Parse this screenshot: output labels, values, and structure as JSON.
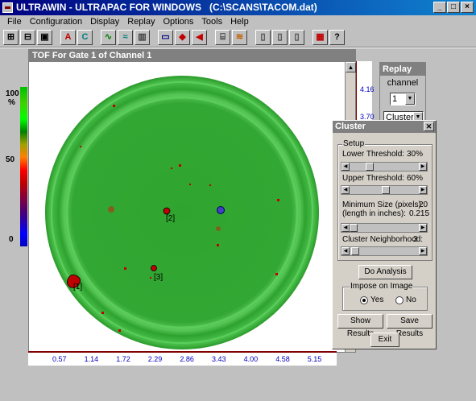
{
  "window": {
    "app_name": "ULTRAWIN",
    "title_rest": " - ULTRAPAC FOR WINDOWS   (C:\\SCANS\\TACOM.dat)",
    "min": "_",
    "max": "□",
    "close": "×"
  },
  "menu": [
    {
      "label": "File"
    },
    {
      "label": "Configuration"
    },
    {
      "label": "Display"
    },
    {
      "label": "Replay"
    },
    {
      "label": "Options"
    },
    {
      "label": "Tools"
    },
    {
      "label": "Help"
    }
  ],
  "toolbar": [
    {
      "glyph": "⊞",
      "color": "#000000"
    },
    {
      "glyph": "⊟",
      "color": "#000000"
    },
    {
      "glyph": "▣",
      "color": "#000000"
    },
    {
      "glyph": "A",
      "color": "#c00000"
    },
    {
      "glyph": "C",
      "color": "#008080"
    },
    {
      "glyph": "∿",
      "color": "#008000"
    },
    {
      "glyph": "≈",
      "color": "#008080"
    },
    {
      "glyph": "▥",
      "color": "#404040"
    },
    {
      "glyph": "▭",
      "color": "#000080"
    },
    {
      "glyph": "◆",
      "color": "#c00000"
    },
    {
      "glyph": "◀",
      "color": "#c00000"
    },
    {
      "glyph": "⌸",
      "color": "#404040"
    },
    {
      "glyph": "≋",
      "color": "#c06000"
    },
    {
      "glyph": "▯",
      "color": "#404040"
    },
    {
      "glyph": "▯",
      "color": "#404040"
    },
    {
      "glyph": "▯",
      "color": "#404040"
    },
    {
      "glyph": "▦",
      "color": "#c00000"
    },
    {
      "glyph": "?",
      "color": "#000000"
    }
  ],
  "image_window": {
    "title": "TOF For Gate 1 of Channel 1",
    "scroll_up": "▲",
    "scroll_down": "▼"
  },
  "scale": {
    "top": "100",
    "unit": "%",
    "mid": "50",
    "bottom": "0"
  },
  "right_ruler": {
    "v1": "4.16",
    "v2": "3.70"
  },
  "bottom_ruler": [
    "0.57",
    "1.14",
    "1.72",
    "2.29",
    "2.86",
    "3.43",
    "4.00",
    "4.58",
    "5.15"
  ],
  "defects": [
    {
      "label": "[1]"
    },
    {
      "label": "[2]"
    },
    {
      "label": "[3]"
    }
  ],
  "replay": {
    "title": "Replay",
    "channel_label": "channel",
    "channel_value": "1",
    "mode_value": "Cluster"
  },
  "cluster": {
    "title": "Cluster",
    "setup_title": "Setup",
    "lower_threshold_label": "Lower Threshold:",
    "lower_threshold_value": "30%",
    "lower_threshold_level": 0.3,
    "upper_threshold_label": "Upper Threshold:",
    "upper_threshold_value": "60%",
    "upper_threshold_level": 0.6,
    "min_size_label": "Minimum Size (pixels):",
    "min_size_value": "20",
    "length_label": "(length in inches):",
    "length_value": "0.215",
    "neighborhood_label": "Cluster Neighborhood:",
    "neighborhood_value": "3",
    "do_analysis": "Do Analysis",
    "impose_title": "Impose on Image",
    "yes_label": "Yes",
    "no_label": "No",
    "impose_selected": "Yes",
    "show_results": "Show Results",
    "save_results": "Save Results",
    "exit": "Exit"
  },
  "colors": {
    "title_active": "#000080",
    "inactive_title": "#808080",
    "scan_green": "#2ea82e",
    "defect_red": "#c00000"
  }
}
